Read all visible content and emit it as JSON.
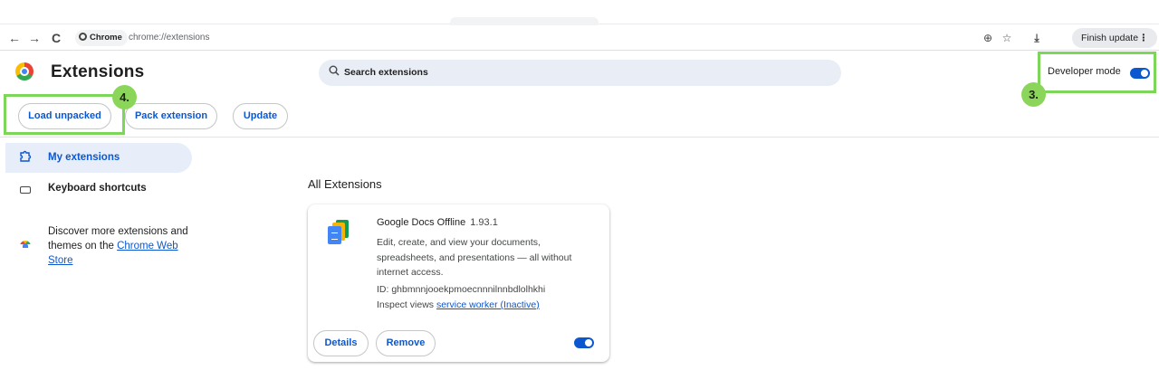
{
  "browser": {
    "nav_back": "←",
    "nav_forward": "→",
    "nav_reload": "C",
    "chip_label": "Chrome",
    "url": "chrome://extensions",
    "zoom_icon": "⊕",
    "star_icon": "☆",
    "download_icon": "⤓",
    "finish_update": "Finish update",
    "menu_dots": "⋮"
  },
  "header": {
    "title": "Extensions",
    "search_placeholder": "Search extensions",
    "developer_mode_label": "Developer mode",
    "developer_mode_on": true
  },
  "toolbar": {
    "load_unpacked": "Load unpacked",
    "pack_extension": "Pack extension",
    "update": "Update"
  },
  "annotations": {
    "badge_3": "3.",
    "badge_4": "4.",
    "highlight_color": "#7cd65a"
  },
  "sidebar": {
    "items": [
      {
        "label": "My extensions",
        "icon": "puzzle-icon",
        "active": true
      },
      {
        "label": "Keyboard shortcuts",
        "icon": "keyboard-icon",
        "active": false
      }
    ],
    "discover_text": "Discover more extensions and themes on the ",
    "discover_link": "Chrome Web Store"
  },
  "main": {
    "section_title": "All Extensions",
    "extensions": [
      {
        "name": "Google Docs Offline",
        "version": "1.93.1",
        "description": "Edit, create, and view your documents, spreadsheets, and presentations — all without internet access.",
        "id_label": "ID: ghbmnnjooekpmoecnnnilnnbdlolhkhi",
        "inspect_label": "Inspect views ",
        "inspect_link": "service worker (Inactive)",
        "details_button": "Details",
        "remove_button": "Remove",
        "enabled": true
      }
    ]
  },
  "colors": {
    "accent": "#0b57d0",
    "search_bg": "#e9eef6",
    "active_nav_bg": "#e8eef9"
  }
}
